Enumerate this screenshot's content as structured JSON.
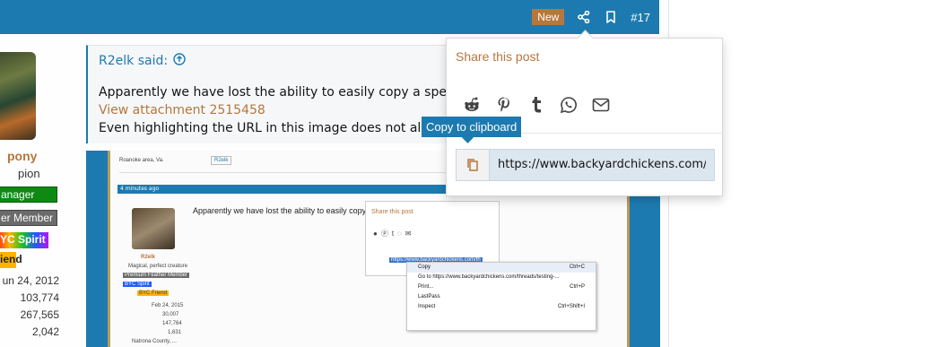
{
  "topbar": {
    "new_badge": "New",
    "post_number": "#17",
    "color": "#1d7ab0"
  },
  "user": {
    "name": "pony",
    "title": "pion",
    "badges": [
      "anager",
      "er Member",
      "YC Spirit",
      "iend"
    ],
    "stats": [
      "un 24, 2012",
      "103,774",
      "267,565",
      "2,042"
    ]
  },
  "quote": {
    "author": "R2elk said:",
    "line1": "Apparently we have lost the ability to easily copy a spe",
    "attachment_link": "View attachment 2515458",
    "line3": "Even highlighting the URL in this image does not al"
  },
  "attachment_image": {
    "top_user_tag": "R2elk",
    "top_location": "Roanoke area, Va.",
    "timestamp": "4 minutes ago",
    "heading": "Apparently we have lost the ability to easily copy a s",
    "mini_user": "R2elk",
    "mini_title": "Magical, perfect creature",
    "mini_badge_1": "Premium Feather Member",
    "mini_badge_2": "BYC Spirit",
    "mini_badge_3": "BYC Friend",
    "mini_date": "Feb 24, 2015",
    "mini_stats": [
      "30,007",
      "147,764",
      "1,631"
    ],
    "mini_location": "Natrona County, ...",
    "mini_share_title": "Share this post",
    "mini_url": "https://www.backyardchickens.com/th",
    "context_menu": [
      {
        "label": "Copy",
        "shortcut": "Ctrl+C"
      },
      {
        "label": "Go to https://www.backyardchickens.com/threads/testing-...",
        "shortcut": ""
      },
      {
        "label": "Print...",
        "shortcut": "Ctrl+P"
      },
      {
        "label": "LastPass",
        "shortcut": ""
      },
      {
        "label": "Inspect",
        "shortcut": "Ctrl+Shift+I"
      }
    ]
  },
  "share_popup": {
    "title": "Share this post",
    "icons": [
      "reddit-icon",
      "pinterest-icon",
      "tumblr-icon",
      "whatsapp-icon",
      "email-icon"
    ],
    "url": "https://www.backyardchickens.com/th",
    "tooltip": "Copy to clipboard"
  }
}
